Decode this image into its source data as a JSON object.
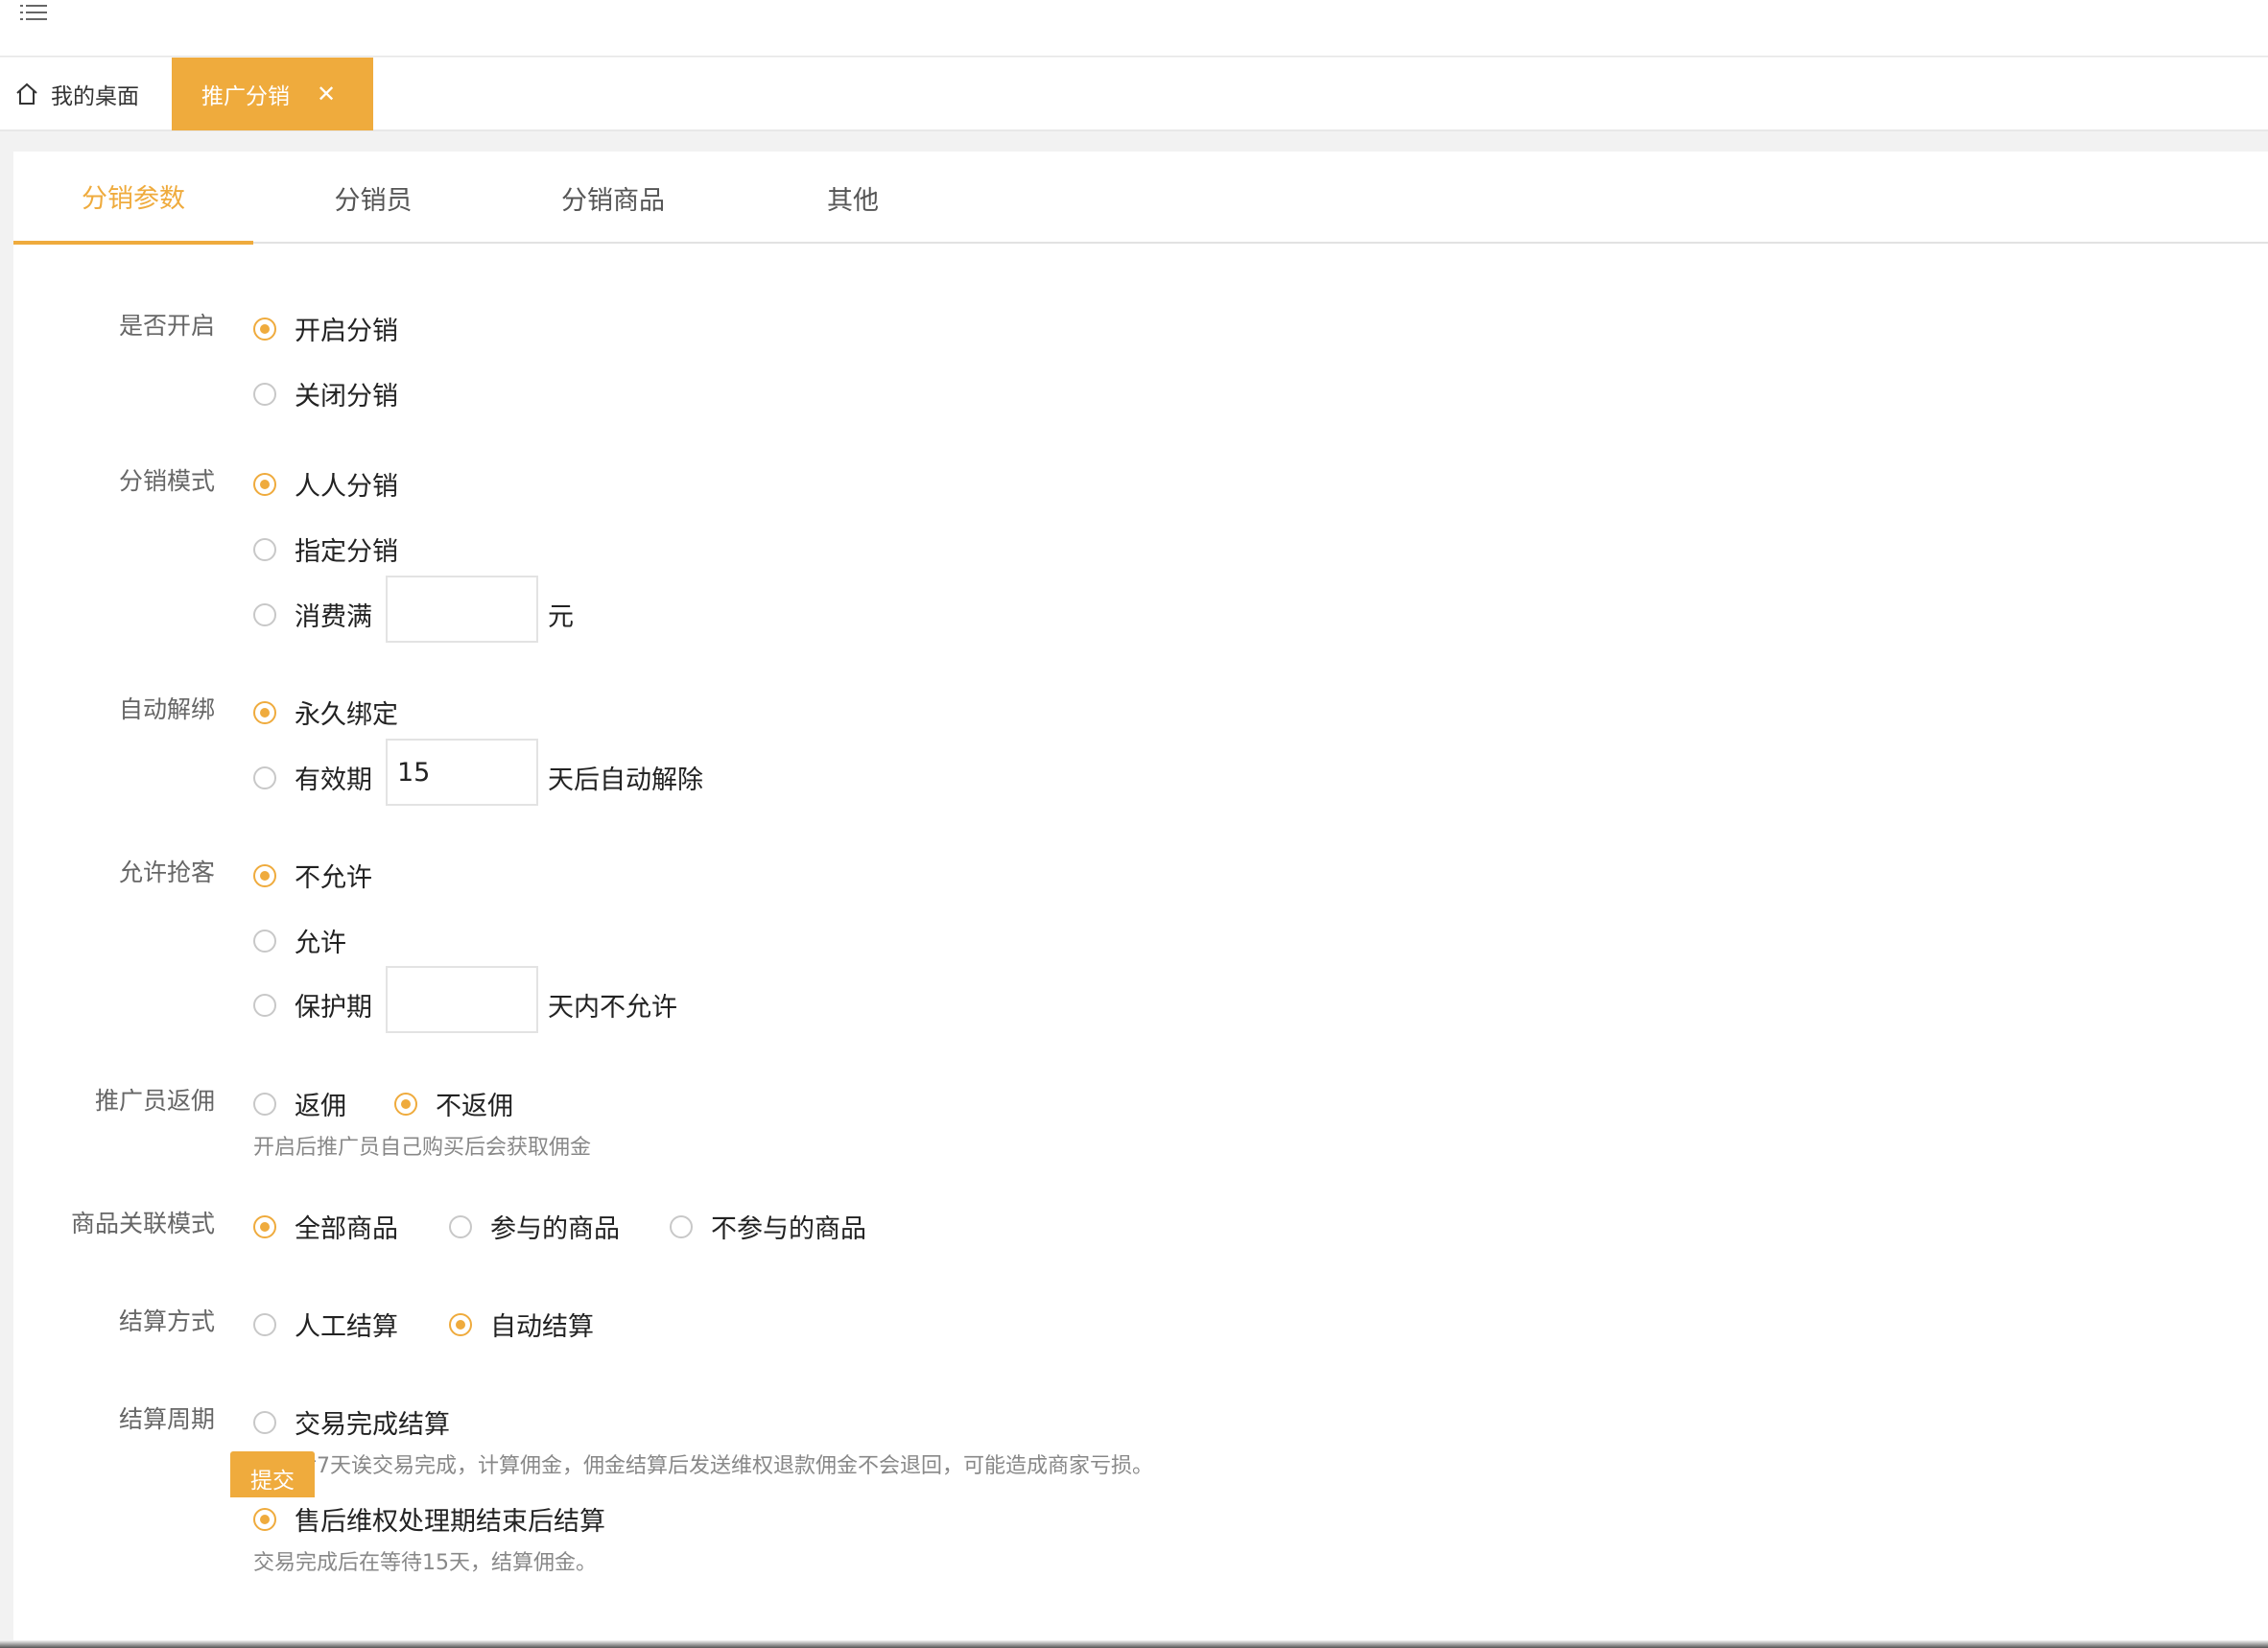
{
  "home_tab": {
    "label": "我的桌面"
  },
  "active_tab": {
    "label": "推广分销",
    "close": "✕"
  },
  "subtabs": [
    {
      "label": "分销参数"
    },
    {
      "label": "分销员"
    },
    {
      "label": "分销商品"
    },
    {
      "label": "其他"
    }
  ],
  "accent_color": "#efab3d",
  "form": {
    "enable": {
      "label": "是否开启",
      "options": [
        "开启分销",
        "关闭分销"
      ],
      "selected": 0
    },
    "mode": {
      "label": "分销模式",
      "options": [
        "人人分销",
        "指定分销",
        "消费满"
      ],
      "selected": 0,
      "spend_value": "",
      "spend_unit": "元"
    },
    "unbind": {
      "label": "自动解绑",
      "options": [
        "永久绑定",
        "有效期"
      ],
      "selected": 0,
      "valid_days": "15",
      "valid_suffix": "天后自动解除"
    },
    "grab": {
      "label": "允许抢客",
      "options": [
        "不允许",
        "允许",
        "保护期"
      ],
      "selected": 0,
      "protect_days": "",
      "protect_suffix": "天内不允许"
    },
    "rebate": {
      "label": "推广员返佣",
      "options": [
        "返佣",
        "不返佣"
      ],
      "selected": 1,
      "hint": "开启后推广员自己购买后会获取佣金"
    },
    "goods_mode": {
      "label": "商品关联模式",
      "options": [
        "全部商品",
        "参与的商品",
        "不参与的商品"
      ],
      "selected": 0
    },
    "settle_method": {
      "label": "结算方式",
      "options": [
        "人工结算",
        "自动结算"
      ],
      "selected": 1
    },
    "settle_cycle": {
      "label": "结算周期",
      "options": [
        "交易完成结算",
        "售后维权处理期结束后结算"
      ],
      "selected": 1,
      "hints": [
        "发货后7天诶交易完成，计算佣金，佣金结算后发送维权退款佣金不会退回，可能造成商家亏损。",
        "交易完成后在等待15天，结算佣金。"
      ]
    }
  },
  "submit_label": "提交"
}
